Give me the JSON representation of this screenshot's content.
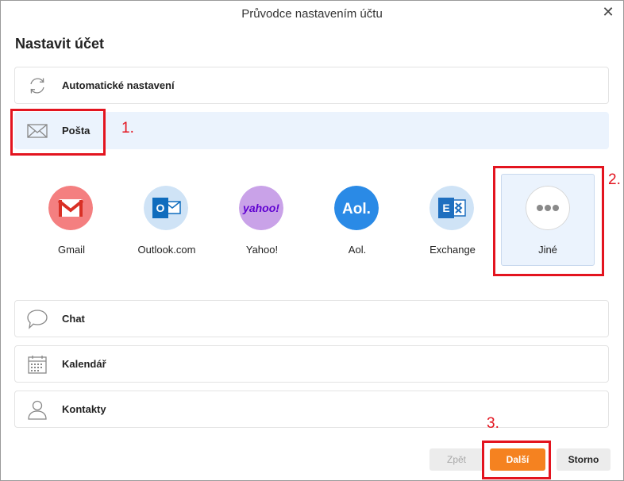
{
  "window": {
    "title": "Průvodce nastavením účtu",
    "close_symbol": "✕"
  },
  "heading": "Nastavit účet",
  "rows": {
    "auto": {
      "label": "Automatické nastavení",
      "icon": "sync-icon"
    },
    "mail": {
      "label": "Pošta",
      "icon": "envelope-icon"
    },
    "chat": {
      "label": "Chat",
      "icon": "chat-bubble-icon"
    },
    "calendar": {
      "label": "Kalendář",
      "icon": "calendar-icon"
    },
    "contacts": {
      "label": "Kontakty",
      "icon": "person-icon"
    }
  },
  "providers": {
    "gmail": {
      "label": "Gmail",
      "icon": "gmail-logo"
    },
    "outlook": {
      "label": "Outlook.com",
      "icon": "outlook-logo"
    },
    "yahoo": {
      "label": "Yahoo!",
      "icon": "yahoo-logo",
      "logo_text": "yahoo!"
    },
    "aol": {
      "label": "Aol.",
      "icon": "aol-logo",
      "logo_text": "Aol."
    },
    "exchange": {
      "label": "Exchange",
      "icon": "exchange-logo"
    },
    "other": {
      "label": "Jiné",
      "icon": "more-dots-icon"
    }
  },
  "buttons": {
    "back": "Zpět",
    "next": "Další",
    "cancel": "Storno"
  },
  "annotations": {
    "step1": "1.",
    "step2": "2.",
    "step3": "3."
  },
  "colors": {
    "accent": "#f58220",
    "selected_bg": "#ebf3fd",
    "annotation_red": "#e3141f",
    "gmail_bg": "#f47f80",
    "outlook_bg": "#cfe3f6",
    "yahoo_bg": "#c9a2e8",
    "aol_bg": "#2a8ae6",
    "exchange_bg": "#cfe3f6"
  }
}
